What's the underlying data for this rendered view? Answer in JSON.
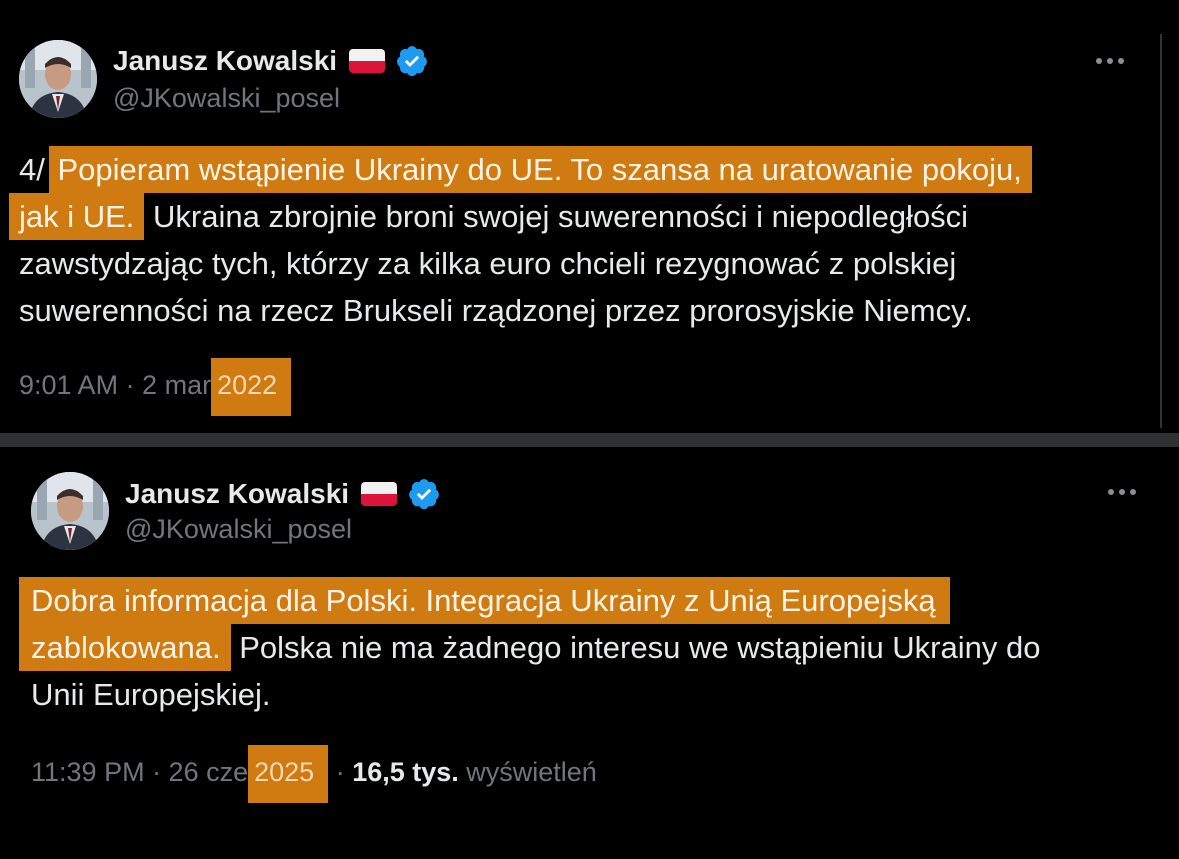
{
  "tweets": [
    {
      "author": "Janusz Kowalski",
      "handle": "@JKowalski_posel",
      "lines": [
        {
          "pre": "4/ ",
          "hl": "Popieram wstąpienie Ukrainy do UE. To szansa na uratowanie pokoju,",
          "post": ""
        },
        {
          "pre": "",
          "hl": "jak i UE.",
          "post": " Ukraina zbrojnie broni swojej suwerenności i niepodległości"
        },
        {
          "pre": "zawstydzając tych, którzy za kilka euro chcieli rezygnować z polskiej",
          "hl": "",
          "post": ""
        },
        {
          "pre": "suwerenności na rzecz Brukseli rządzonej przez prorosyjskie Niemcy.",
          "hl": "",
          "post": ""
        }
      ],
      "time": "9:01 AM · 2 mar",
      "year": "2022"
    },
    {
      "author": "Janusz Kowalski",
      "handle": "@JKowalski_posel",
      "lines": [
        {
          "pre": "",
          "hl": "Dobra informacja dla Polski. Integracja Ukrainy z Unią Europejską",
          "post": ""
        },
        {
          "pre": "",
          "hl": "zablokowana.",
          "post": " Polska nie ma żadnego interesu we wstąpieniu Ukrainy do"
        },
        {
          "pre": "Unii Europejskiej.",
          "hl": "",
          "post": ""
        }
      ],
      "time": "11:39 PM · 26 cze",
      "year": "2025",
      "views_sep": " · ",
      "views_count": "16,5 tys.",
      "views_label": " wyświetleń"
    }
  ],
  "colors": {
    "highlight": "#d07a12",
    "verified": "#1d9bf0",
    "background": "#000000"
  },
  "icons": {
    "flag": "poland-flag-icon",
    "verified": "verified-badge-icon",
    "more": "more-options-icon"
  }
}
